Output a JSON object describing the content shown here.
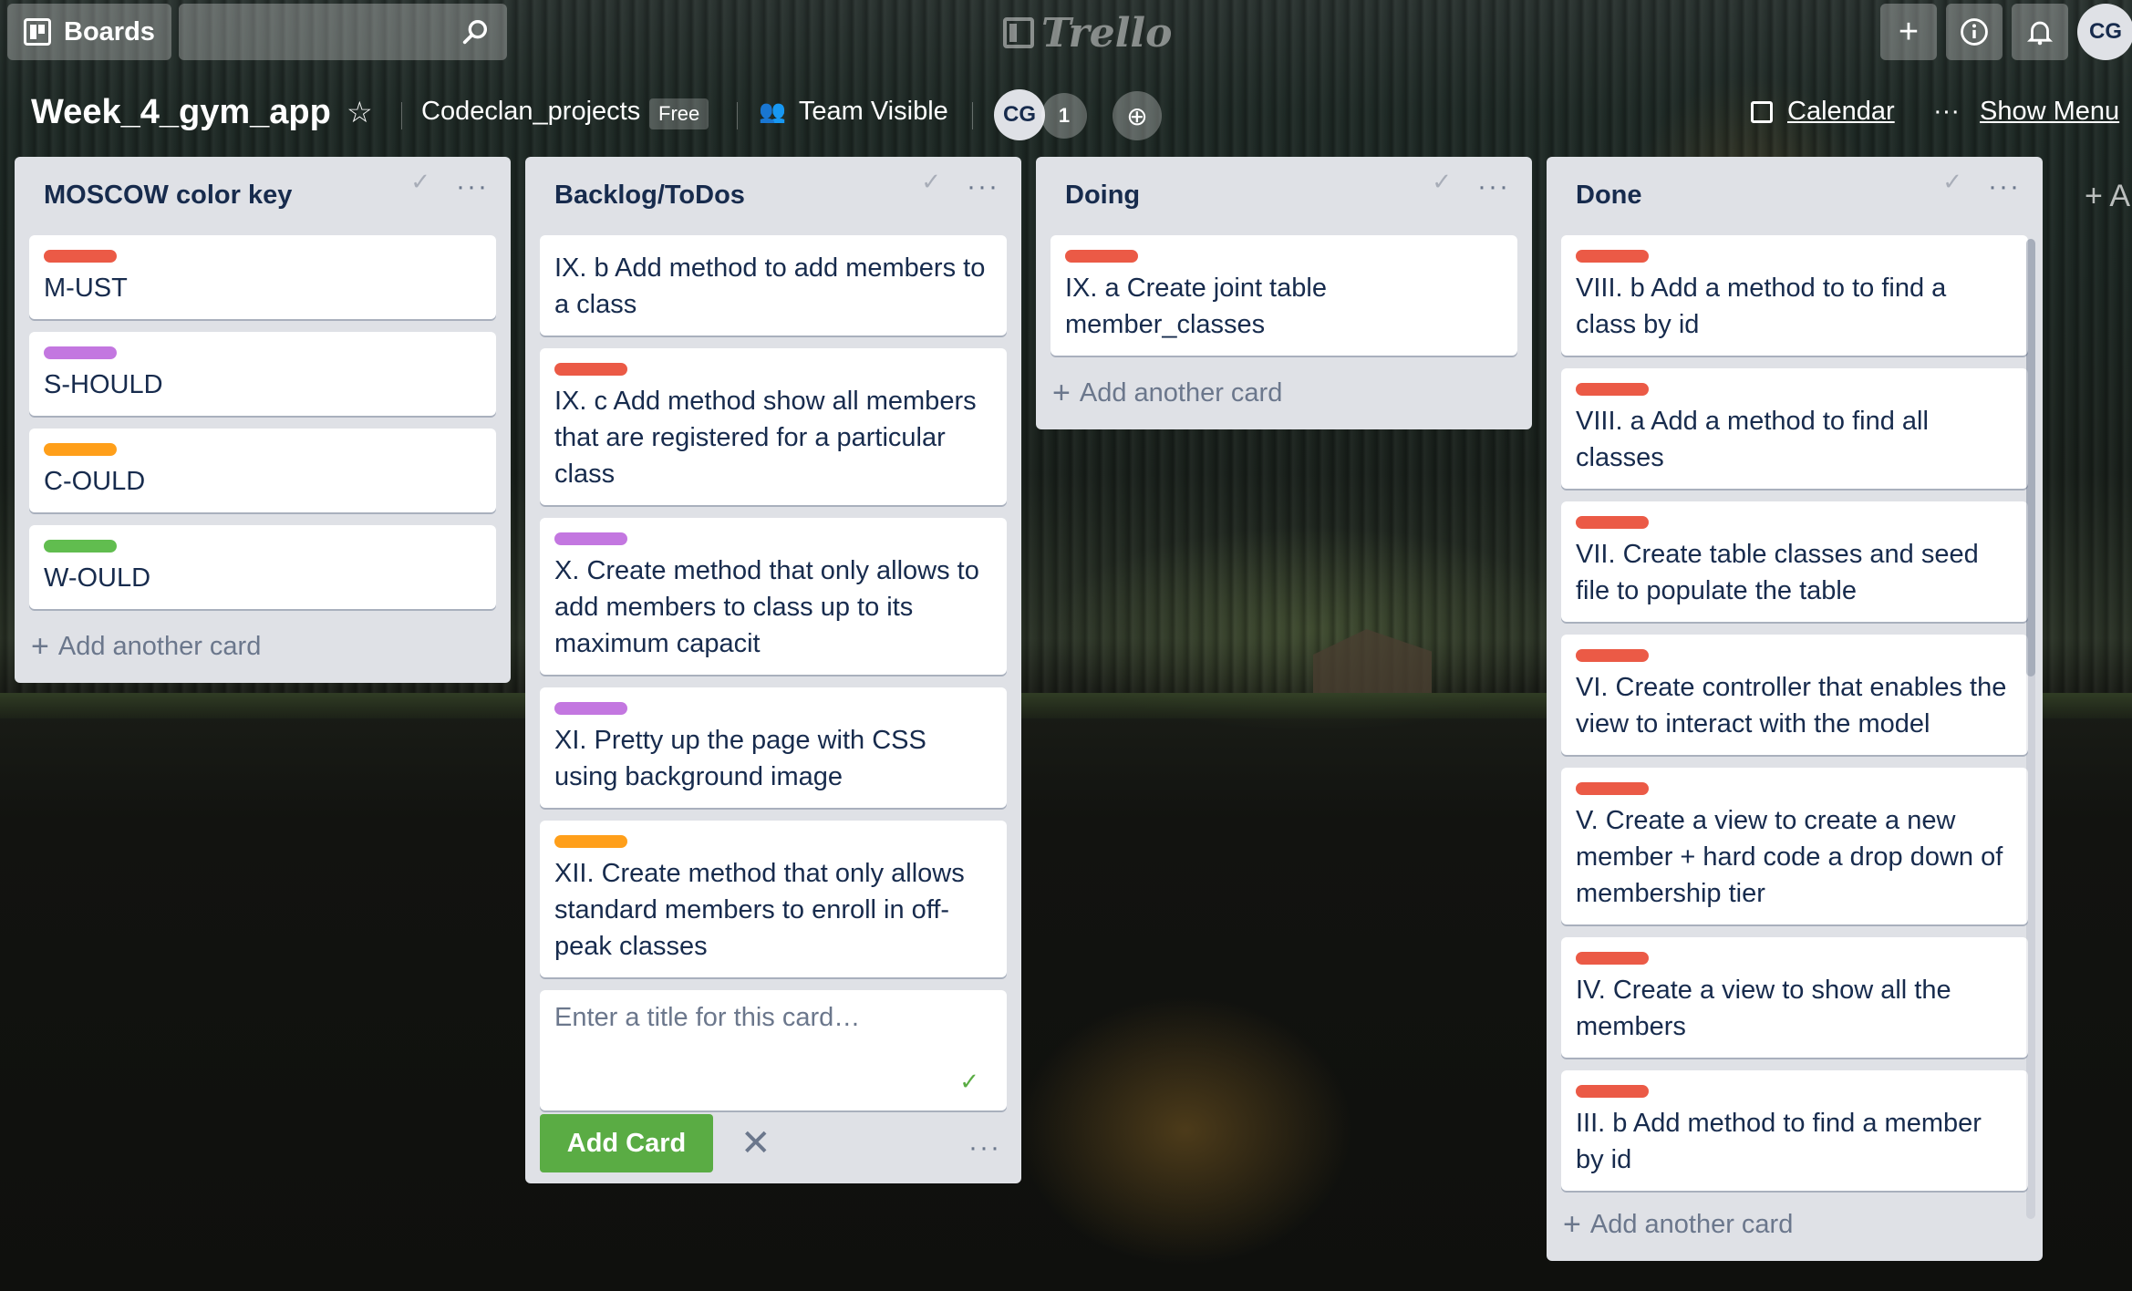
{
  "header": {
    "boards_label": "Boards",
    "logo_text": "Trello",
    "avatar_initials": "CG"
  },
  "board": {
    "title": "Week_4_gym_app",
    "team": "Codeclan_projects",
    "plan_badge": "Free",
    "visibility": "Team Visible",
    "member_initials": "CG",
    "member_count": "1",
    "calendar_label": "Calendar",
    "menu_label": "Show Menu",
    "add_list_label": "+ A"
  },
  "label_colors": {
    "red": "#eb5a46",
    "purple": "#c377e0",
    "orange": "#ff9f1a",
    "green": "#61bd4f"
  },
  "lists": [
    {
      "title": "MOSCOW color key",
      "cards": [
        {
          "label": "red",
          "text": "M-UST"
        },
        {
          "label": "purple",
          "text": "S-HOULD"
        },
        {
          "label": "orange",
          "text": "C-OULD"
        },
        {
          "label": "green",
          "text": "W-OULD"
        }
      ],
      "add_card": "Add another card"
    },
    {
      "title": "Backlog/ToDos",
      "cards": [
        {
          "label": null,
          "text": "IX. b Add method to add members to a class"
        },
        {
          "label": "red",
          "text": "IX. c Add method show all members that are registered for a particular class"
        },
        {
          "label": "purple",
          "text": "X. Create method that only allows to add members to class up to its maximum capacit"
        },
        {
          "label": "purple",
          "text": "XI. Pretty up the page with CSS using background image"
        },
        {
          "label": "orange",
          "text": "XII. Create method that only allows standard members to enroll in off-peak classes"
        }
      ],
      "composer_placeholder": "Enter a title for this card…",
      "add_button": "Add Card"
    },
    {
      "title": "Doing",
      "cards": [
        {
          "label": "red",
          "text": "IX. a Create joint table member_classes"
        }
      ],
      "add_card": "Add another card"
    },
    {
      "title": "Done",
      "cards": [
        {
          "label": "red",
          "text": "VIII. b Add a method to to find a class by id"
        },
        {
          "label": "red",
          "text": "VIII. a Add a method to find all classes"
        },
        {
          "label": "red",
          "text": "VII. Create table classes and seed file to populate the table"
        },
        {
          "label": "red",
          "text": "VI. Create controller that enables the view to interact with the model"
        },
        {
          "label": "red",
          "text": "V. Create a view to create a new member + hard code a drop down of membership tier"
        },
        {
          "label": "red",
          "text": "IV. Create a view to show all the members"
        },
        {
          "label": "red",
          "text": "III. b Add method to find a member by id"
        },
        {
          "label": "red",
          "text": ""
        }
      ],
      "add_card": "Add another card"
    }
  ]
}
